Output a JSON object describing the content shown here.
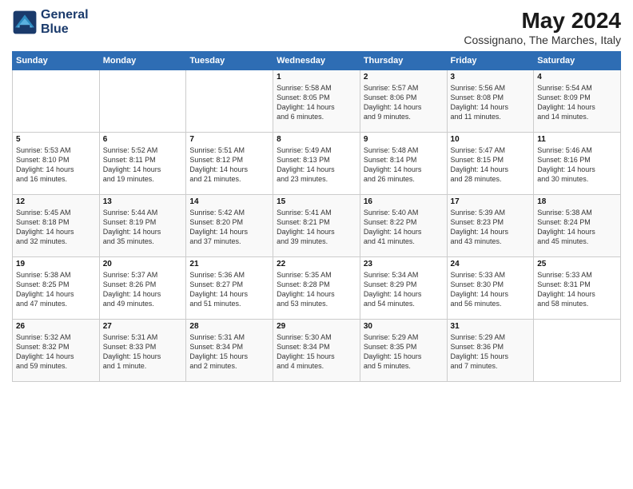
{
  "header": {
    "logo_line1": "General",
    "logo_line2": "Blue",
    "month": "May 2024",
    "location": "Cossignano, The Marches, Italy"
  },
  "days_of_week": [
    "Sunday",
    "Monday",
    "Tuesday",
    "Wednesday",
    "Thursday",
    "Friday",
    "Saturday"
  ],
  "weeks": [
    [
      {
        "day": "",
        "text": ""
      },
      {
        "day": "",
        "text": ""
      },
      {
        "day": "",
        "text": ""
      },
      {
        "day": "1",
        "text": "Sunrise: 5:58 AM\nSunset: 8:05 PM\nDaylight: 14 hours\nand 6 minutes."
      },
      {
        "day": "2",
        "text": "Sunrise: 5:57 AM\nSunset: 8:06 PM\nDaylight: 14 hours\nand 9 minutes."
      },
      {
        "day": "3",
        "text": "Sunrise: 5:56 AM\nSunset: 8:08 PM\nDaylight: 14 hours\nand 11 minutes."
      },
      {
        "day": "4",
        "text": "Sunrise: 5:54 AM\nSunset: 8:09 PM\nDaylight: 14 hours\nand 14 minutes."
      }
    ],
    [
      {
        "day": "5",
        "text": "Sunrise: 5:53 AM\nSunset: 8:10 PM\nDaylight: 14 hours\nand 16 minutes."
      },
      {
        "day": "6",
        "text": "Sunrise: 5:52 AM\nSunset: 8:11 PM\nDaylight: 14 hours\nand 19 minutes."
      },
      {
        "day": "7",
        "text": "Sunrise: 5:51 AM\nSunset: 8:12 PM\nDaylight: 14 hours\nand 21 minutes."
      },
      {
        "day": "8",
        "text": "Sunrise: 5:49 AM\nSunset: 8:13 PM\nDaylight: 14 hours\nand 23 minutes."
      },
      {
        "day": "9",
        "text": "Sunrise: 5:48 AM\nSunset: 8:14 PM\nDaylight: 14 hours\nand 26 minutes."
      },
      {
        "day": "10",
        "text": "Sunrise: 5:47 AM\nSunset: 8:15 PM\nDaylight: 14 hours\nand 28 minutes."
      },
      {
        "day": "11",
        "text": "Sunrise: 5:46 AM\nSunset: 8:16 PM\nDaylight: 14 hours\nand 30 minutes."
      }
    ],
    [
      {
        "day": "12",
        "text": "Sunrise: 5:45 AM\nSunset: 8:18 PM\nDaylight: 14 hours\nand 32 minutes."
      },
      {
        "day": "13",
        "text": "Sunrise: 5:44 AM\nSunset: 8:19 PM\nDaylight: 14 hours\nand 35 minutes."
      },
      {
        "day": "14",
        "text": "Sunrise: 5:42 AM\nSunset: 8:20 PM\nDaylight: 14 hours\nand 37 minutes."
      },
      {
        "day": "15",
        "text": "Sunrise: 5:41 AM\nSunset: 8:21 PM\nDaylight: 14 hours\nand 39 minutes."
      },
      {
        "day": "16",
        "text": "Sunrise: 5:40 AM\nSunset: 8:22 PM\nDaylight: 14 hours\nand 41 minutes."
      },
      {
        "day": "17",
        "text": "Sunrise: 5:39 AM\nSunset: 8:23 PM\nDaylight: 14 hours\nand 43 minutes."
      },
      {
        "day": "18",
        "text": "Sunrise: 5:38 AM\nSunset: 8:24 PM\nDaylight: 14 hours\nand 45 minutes."
      }
    ],
    [
      {
        "day": "19",
        "text": "Sunrise: 5:38 AM\nSunset: 8:25 PM\nDaylight: 14 hours\nand 47 minutes."
      },
      {
        "day": "20",
        "text": "Sunrise: 5:37 AM\nSunset: 8:26 PM\nDaylight: 14 hours\nand 49 minutes."
      },
      {
        "day": "21",
        "text": "Sunrise: 5:36 AM\nSunset: 8:27 PM\nDaylight: 14 hours\nand 51 minutes."
      },
      {
        "day": "22",
        "text": "Sunrise: 5:35 AM\nSunset: 8:28 PM\nDaylight: 14 hours\nand 53 minutes."
      },
      {
        "day": "23",
        "text": "Sunrise: 5:34 AM\nSunset: 8:29 PM\nDaylight: 14 hours\nand 54 minutes."
      },
      {
        "day": "24",
        "text": "Sunrise: 5:33 AM\nSunset: 8:30 PM\nDaylight: 14 hours\nand 56 minutes."
      },
      {
        "day": "25",
        "text": "Sunrise: 5:33 AM\nSunset: 8:31 PM\nDaylight: 14 hours\nand 58 minutes."
      }
    ],
    [
      {
        "day": "26",
        "text": "Sunrise: 5:32 AM\nSunset: 8:32 PM\nDaylight: 14 hours\nand 59 minutes."
      },
      {
        "day": "27",
        "text": "Sunrise: 5:31 AM\nSunset: 8:33 PM\nDaylight: 15 hours\nand 1 minute."
      },
      {
        "day": "28",
        "text": "Sunrise: 5:31 AM\nSunset: 8:34 PM\nDaylight: 15 hours\nand 2 minutes."
      },
      {
        "day": "29",
        "text": "Sunrise: 5:30 AM\nSunset: 8:34 PM\nDaylight: 15 hours\nand 4 minutes."
      },
      {
        "day": "30",
        "text": "Sunrise: 5:29 AM\nSunset: 8:35 PM\nDaylight: 15 hours\nand 5 minutes."
      },
      {
        "day": "31",
        "text": "Sunrise: 5:29 AM\nSunset: 8:36 PM\nDaylight: 15 hours\nand 7 minutes."
      },
      {
        "day": "",
        "text": ""
      }
    ]
  ]
}
